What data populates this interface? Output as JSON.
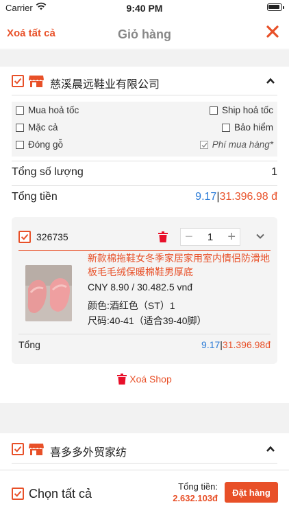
{
  "status_bar": {
    "carrier": "Carrier",
    "time": "9:40 PM"
  },
  "nav": {
    "clear_all": "Xoá tất cả",
    "title": "Giỏ hàng"
  },
  "shops": [
    {
      "name": "慈溪晨远鞋业有限公司",
      "options": {
        "express": "Mua hoả tốc",
        "ship_express": "Ship hoả tốc",
        "bargain": "Mặc cả",
        "insurance": "Bảo hiểm",
        "wood_pack": "Đóng gỗ",
        "purchase_fee": "Phí mua hàng*"
      },
      "total_qty_label": "Tổng số lượng",
      "total_qty": "1",
      "total_money_label": "Tổng tiền",
      "total_cny": "9.17",
      "total_vnd": "31.396.98 đ",
      "item": {
        "id": "326735",
        "quantity": "1",
        "title": "新款棉拖鞋女冬季家居家用室内情侣防滑地板毛毛绒保暖棉鞋男厚底",
        "price": "CNY 8.90 / 30.482.5 vnđ",
        "color": "颜色:酒红色（ST）1",
        "size": "尺码:40-41（适合39-40脚）",
        "subtotal_label": "Tổng",
        "subtotal_cny": "9.17",
        "subtotal_vnd": "31.396.98đ"
      },
      "delete_shop": "Xoá Shop"
    },
    {
      "name": "喜多多外贸家纺"
    }
  ],
  "bottom": {
    "select_all": "Chọn tất cả",
    "total_label": "Tổng tiền:",
    "total_value": "2.632.103đ",
    "order_button": "Đặt hàng"
  },
  "colors": {
    "accent": "#e85028",
    "blue_price": "#2a7ad6"
  }
}
